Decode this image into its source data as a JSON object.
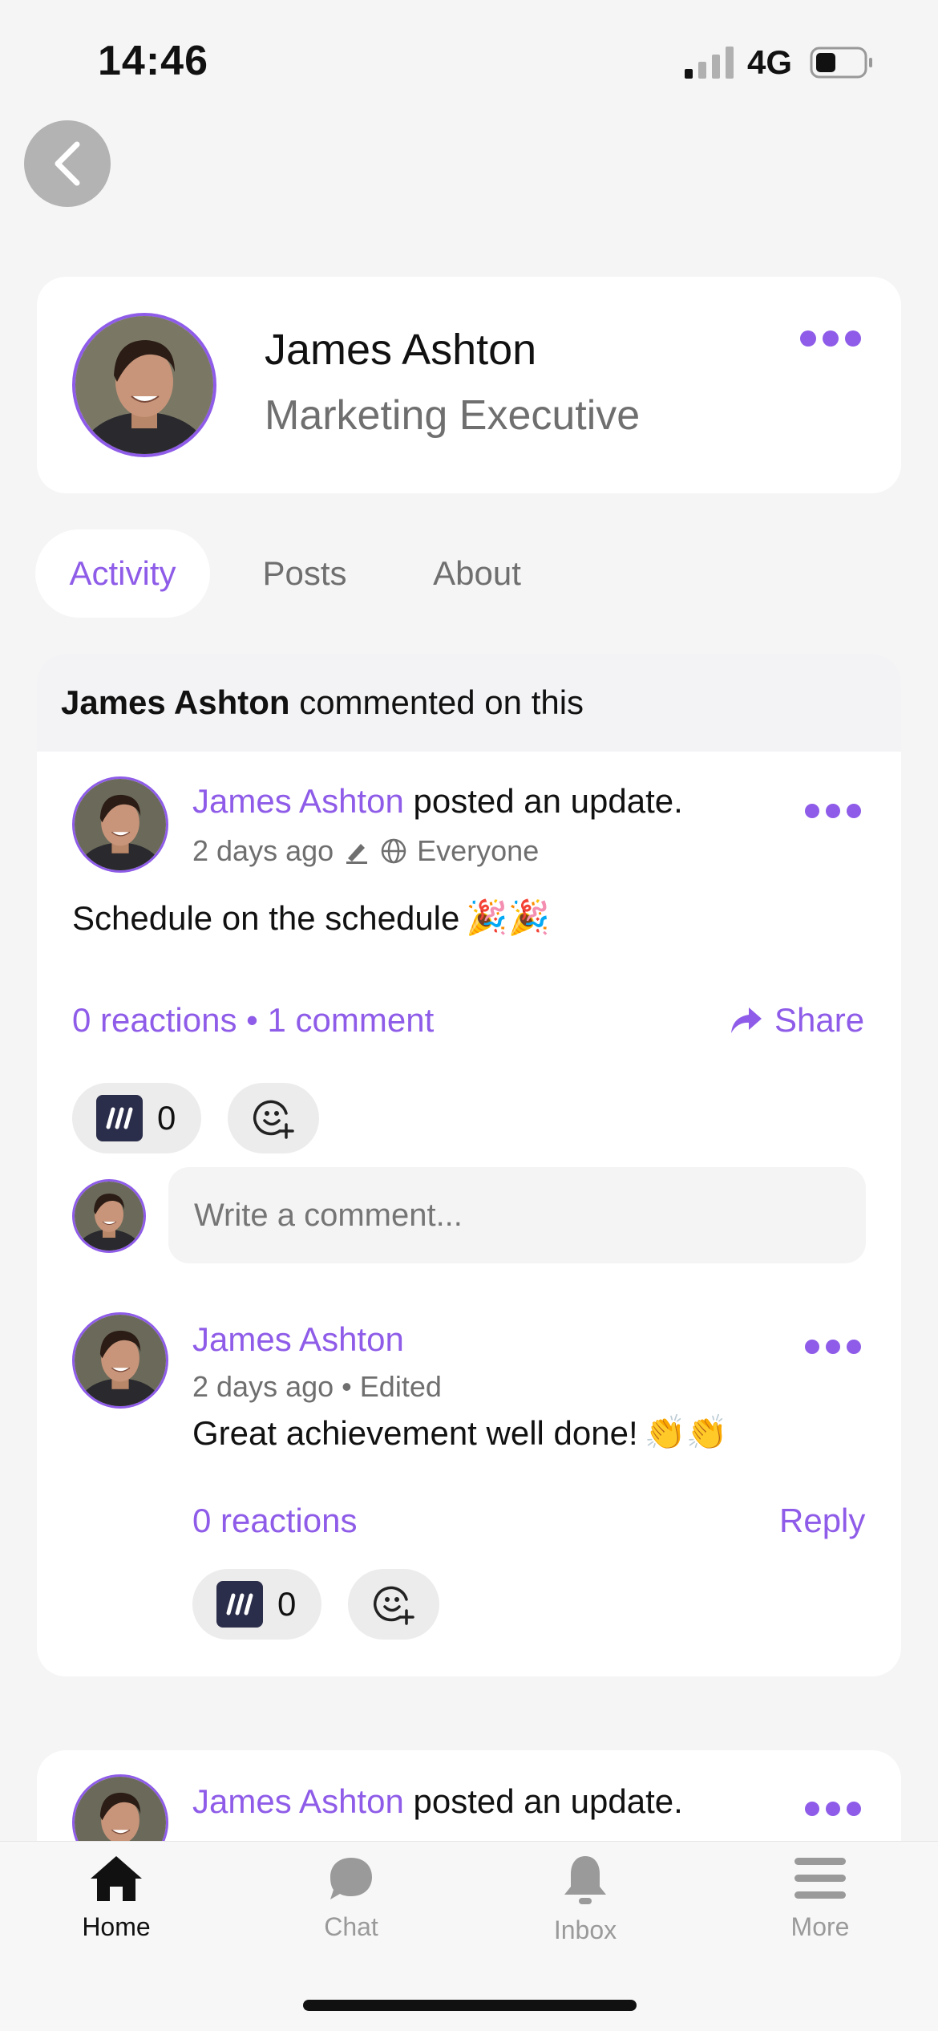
{
  "status_bar": {
    "time": "14:46",
    "network": "4G"
  },
  "profile": {
    "name": "James Ashton",
    "role": "Marketing Executive"
  },
  "tabs": [
    {
      "label": "Activity",
      "active": true
    },
    {
      "label": "Posts",
      "active": false
    },
    {
      "label": "About",
      "active": false
    }
  ],
  "activity": {
    "header_name": "James Ashton",
    "header_action": " commented on this",
    "post": {
      "author": "James Ashton",
      "action": " posted an update.",
      "time": "2 days ago",
      "visibility": "Everyone",
      "body": "Schedule on the schedule",
      "body_emoji": "🎉🎉",
      "reactions": "0 reactions",
      "separator": "•",
      "comments": "1 comment",
      "share": "Share",
      "reaction_count": "0"
    },
    "comment_placeholder": "Write a comment...",
    "comment": {
      "author": "James Ashton",
      "time": "2 days ago",
      "edited": "Edited",
      "meta_sep": "•",
      "body": "Great achievement well done!",
      "body_emoji": "👏👏",
      "reactions": "0 reactions",
      "reply": "Reply",
      "reaction_count": "0"
    }
  },
  "next_post": {
    "author": "James Ashton",
    "action": " posted an update."
  },
  "tabbar": [
    {
      "label": "Home",
      "icon": "home-icon",
      "active": true
    },
    {
      "label": "Chat",
      "icon": "chat-icon",
      "active": false
    },
    {
      "label": "Inbox",
      "icon": "bell-icon",
      "active": false
    },
    {
      "label": "More",
      "icon": "menu-icon",
      "active": false
    }
  ],
  "colors": {
    "accent": "#8e5ce8",
    "background": "#f5f5f5"
  }
}
